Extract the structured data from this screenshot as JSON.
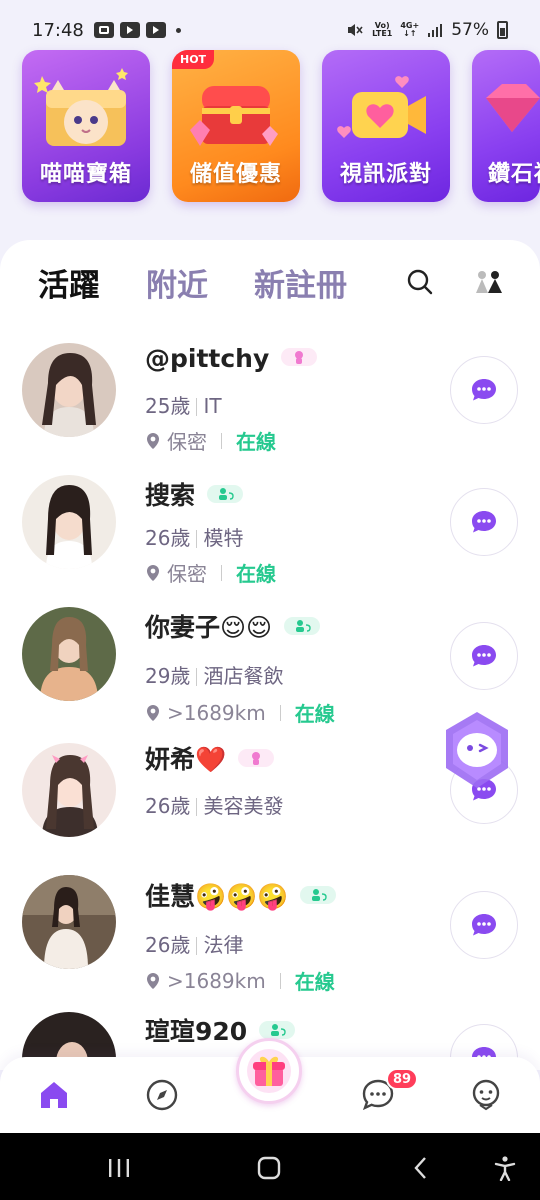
{
  "status_bar": {
    "time": "17:48",
    "net_top": "Vo)",
    "net_bottom": "LTE1",
    "net2_top": "4G+",
    "battery": "57%"
  },
  "banners": [
    {
      "label": "喵喵寶箱",
      "theme": "purple",
      "icon": "cat-treasure-icon"
    },
    {
      "label": "儲值優惠",
      "theme": "orange",
      "icon": "treasure-chest-icon",
      "badge": "HOT"
    },
    {
      "label": "視訊派對",
      "theme": "violet",
      "icon": "video-heart-icon"
    },
    {
      "label": "鑽石福利",
      "theme": "violet",
      "icon": "diamond-icon"
    }
  ],
  "tabs": [
    {
      "label": "活躍",
      "active": true
    },
    {
      "label": "附近",
      "active": false
    },
    {
      "label": "新註冊",
      "active": false
    }
  ],
  "users": [
    {
      "name": "@pittchy",
      "badge": "female",
      "age": "25歲",
      "job": "IT",
      "location": "保密",
      "status": "在線"
    },
    {
      "name": "搜索",
      "badge": "couple",
      "age": "26歲",
      "job": "模特",
      "location": "保密",
      "status": "在線"
    },
    {
      "name": "你妻子😌😌",
      "badge": "couple",
      "age": "29歲",
      "job": "酒店餐飲",
      "location": ">1689km",
      "status": "在線"
    },
    {
      "name": "妍希❤️",
      "badge": "female",
      "age": "26歲",
      "job": "美容美發",
      "location": "",
      "status": ""
    },
    {
      "name": "佳慧🤪🤪🤪",
      "badge": "couple",
      "age": "26歲",
      "job": "法律",
      "location": ">1689km",
      "status": "在線"
    },
    {
      "name": "瑄瑄920",
      "badge": "couple",
      "age": "",
      "job": "",
      "location": "",
      "status": ""
    }
  ],
  "bottom_nav": {
    "items": [
      "home-icon",
      "compass-icon",
      "gift-icon",
      "chat-icon",
      "profile-icon"
    ],
    "chat_badge": "89"
  },
  "colors": {
    "accent": "#8a4af0",
    "online": "#26c98f",
    "tab_inactive": "#8a7fb0"
  }
}
